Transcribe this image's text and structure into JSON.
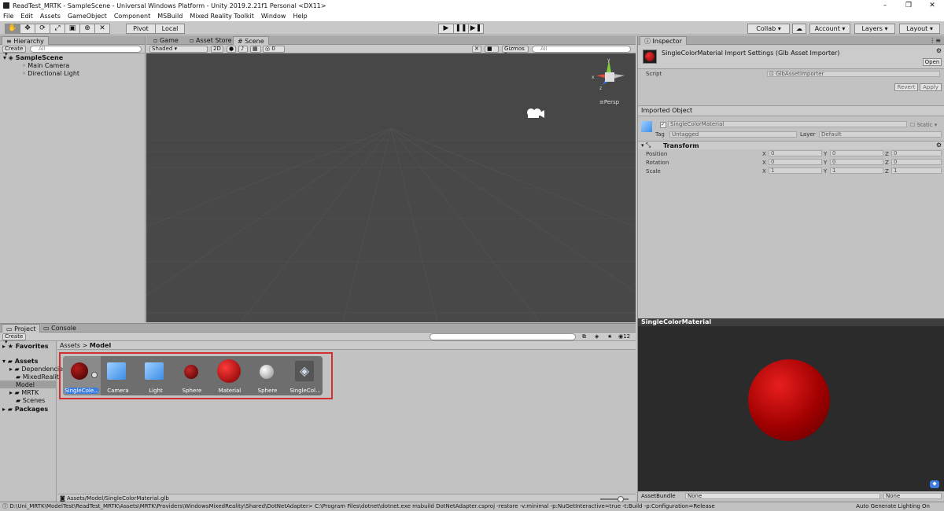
{
  "window": {
    "title": "ReadTest_MRTK - SampleScene - Universal Windows Platform - Unity 2019.2.21f1 Personal <DX11>",
    "controls": [
      "–",
      "❐",
      "✕"
    ]
  },
  "menu": [
    "File",
    "Edit",
    "Assets",
    "GameObject",
    "Component",
    "MSBuild",
    "Mixed Reality Toolkit",
    "Window",
    "Help"
  ],
  "toolbar": {
    "pivot": "Pivot",
    "local": "Local",
    "collab": "Collab",
    "account": "Account",
    "layers": "Layers",
    "layout": "Layout"
  },
  "hierarchy": {
    "tab": "Hierarchy",
    "create": "Create",
    "search_placeholder": "All",
    "scene": "SampleScene",
    "items": [
      "Main Camera",
      "Directional Light"
    ]
  },
  "scene_tabs": {
    "game": "Game",
    "asset_store": "Asset Store",
    "scene": "Scene"
  },
  "scene_bar": {
    "shading": "Shaded",
    "mode_2d": "2D",
    "fx_count": "0",
    "gizmos": "Gizmos",
    "search_placeholder": "All",
    "persp": "Persp",
    "gizmo_axes": [
      "y",
      "x",
      "z"
    ]
  },
  "inspector": {
    "tab": "Inspector",
    "header_title": "SingleColorMaterial Import Settings (Glb Asset Importer)",
    "open_button": "Open",
    "script_label": "Script",
    "script_value": "GlbAssetImporter",
    "revert": "Revert",
    "apply": "Apply",
    "imported_object": "Imported Object",
    "object_name": "SingleColorMaterial",
    "static_label": "Static",
    "tag_label": "Tag",
    "tag_value": "Untagged",
    "layer_label": "Layer",
    "layer_value": "Default",
    "transform_title": "Transform",
    "transform_rows": [
      {
        "label": "Position",
        "x": "0",
        "y": "0",
        "z": "0"
      },
      {
        "label": "Rotation",
        "x": "0",
        "y": "0",
        "z": "0"
      },
      {
        "label": "Scale",
        "x": "1",
        "y": "1",
        "z": "1"
      }
    ],
    "axis": [
      "X",
      "Y",
      "Z"
    ]
  },
  "project": {
    "tabs": [
      "Project",
      "Console"
    ],
    "create": "Create",
    "count": "12",
    "tree": {
      "favorites": "Favorites",
      "assets": "Assets",
      "children": [
        "Dependencies",
        "MixedRealit",
        "Model",
        "MRTK",
        "Scenes"
      ],
      "packages": "Packages"
    },
    "breadcrumb": [
      "Assets",
      "Model"
    ],
    "assets": [
      {
        "name": "SingleCole...",
        "type": "sphere-dark"
      },
      {
        "name": "Camera",
        "type": "prefab"
      },
      {
        "name": "Light",
        "type": "prefab"
      },
      {
        "name": "Sphere",
        "type": "sphere-small"
      },
      {
        "name": "Material",
        "type": "sphere-big"
      },
      {
        "name": "Sphere",
        "type": "sphere-white"
      },
      {
        "name": "SingleCol...",
        "type": "unity"
      }
    ],
    "footer_path": "Assets/Model/SingleColorMaterial.glb"
  },
  "preview": {
    "title": "SingleColorMaterial",
    "asset_bundle": "AssetBundle",
    "bundle_value": "None",
    "variant_value": "None"
  },
  "status": {
    "message": "D:\\Uni_MRTK\\ModelTest\\ReadTest_MRTK\\Assets\\MRTK\\Providers\\WindowsMixedReality\\Shared\\DotNetAdapter> C:\\Program Files\\dotnet\\dotnet.exe msbuild DotNetAdapter.csproj -restore  -v:minimal -p:NuGetInteractive=true  -t:Build -p:Configuration=Release",
    "right": "Auto Generate Lighting On"
  },
  "colors": {
    "accent_red": "#d32f2f",
    "selection": "#3d7de0",
    "scene_bg": "#484848"
  }
}
